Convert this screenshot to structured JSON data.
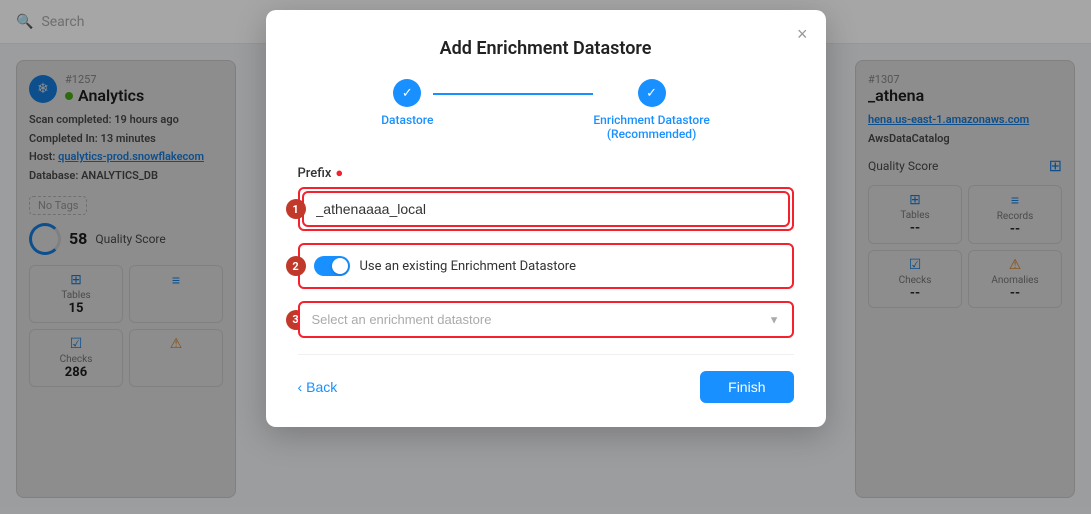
{
  "searchBar": {
    "placeholder": "Search",
    "icon": "search-icon"
  },
  "leftCard": {
    "id": "#1257",
    "title": "Analytics",
    "statusColor": "#52c41a",
    "scanInfo": "Scan completed:",
    "scanTime": "19 hours ago",
    "completedIn": "Completed In:",
    "completedTime": "13 minutes",
    "host": "Host:",
    "hostValue": "qualytics-prod.snowflakecom",
    "database": "Database:",
    "databaseValue": "ANALYTICS_DB",
    "tags": "No Tags",
    "qualityScore": "58",
    "qualityLabel": "Quality Score",
    "metrics": [
      {
        "label": "Tables",
        "value": "15",
        "iconType": "table"
      },
      {
        "label": "",
        "value": "",
        "iconType": "records"
      },
      {
        "label": "Checks",
        "value": "286",
        "iconType": "check"
      },
      {
        "label": "",
        "value": "",
        "iconType": "warning"
      }
    ]
  },
  "rightCard": {
    "id": "#1307",
    "title": "_athena",
    "hostValue": "hena.us-east-1.amazonaws.com",
    "catalogValue": "AwsDataCatalog",
    "qualityLabel": "Quality Score",
    "metrics": [
      {
        "label": "Tables",
        "value": "--",
        "iconType": "table"
      },
      {
        "label": "Records",
        "value": "--",
        "iconType": "records"
      },
      {
        "label": "Checks",
        "value": "--",
        "iconType": "check"
      },
      {
        "label": "Anomalies",
        "value": "--",
        "iconType": "warning"
      }
    ]
  },
  "modal": {
    "title": "Add Enrichment Datastore",
    "closeLabel": "×",
    "steps": [
      {
        "label": "Datastore",
        "completed": true
      },
      {
        "label": "Enrichment Datastore\n(Recommended)",
        "completed": true
      }
    ],
    "prefixLabel": "Prefix",
    "prefixValue": "_athenaaaa_local",
    "prefixPlaceholder": "_athenaaaa_local",
    "step1Number": "1",
    "step2Number": "2",
    "step3Number": "3",
    "toggleLabel": "Use an existing Enrichment Datastore",
    "dropdownPlaceholder": "Select an enrichment datastore",
    "dropdownOptions": [],
    "backLabel": "Back",
    "finishLabel": "Finish",
    "dividerVisible": true
  }
}
